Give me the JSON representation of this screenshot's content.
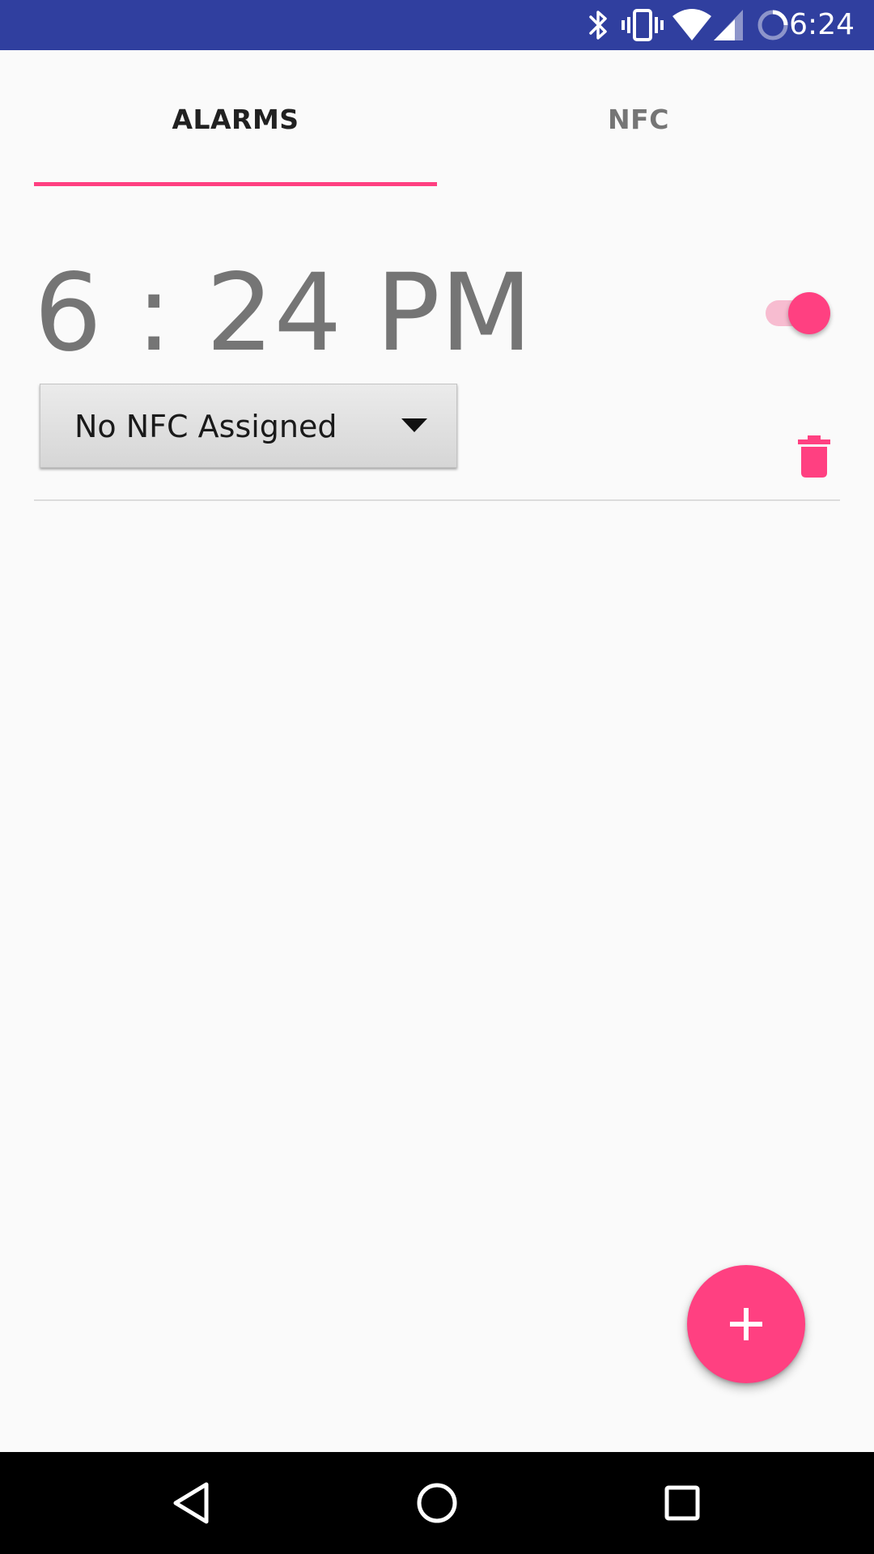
{
  "status_bar": {
    "time": "6:24",
    "background_color": "#303f9f",
    "icons": [
      "bluetooth-icon",
      "vibrate-icon",
      "wifi-icon",
      "cell-signal-icon",
      "battery-icon"
    ]
  },
  "tabs": [
    {
      "label": "ALARMS",
      "selected": true
    },
    {
      "label": "NFC",
      "selected": false
    }
  ],
  "accent_color": "#ff4081",
  "alarms": [
    {
      "time": "6 : 24 PM",
      "enabled": true,
      "nfc_selection": "No NFC Assigned"
    }
  ],
  "fab": {
    "icon": "plus-icon"
  },
  "nav_bar": {
    "buttons": [
      "back-icon",
      "home-icon",
      "recents-icon"
    ]
  }
}
